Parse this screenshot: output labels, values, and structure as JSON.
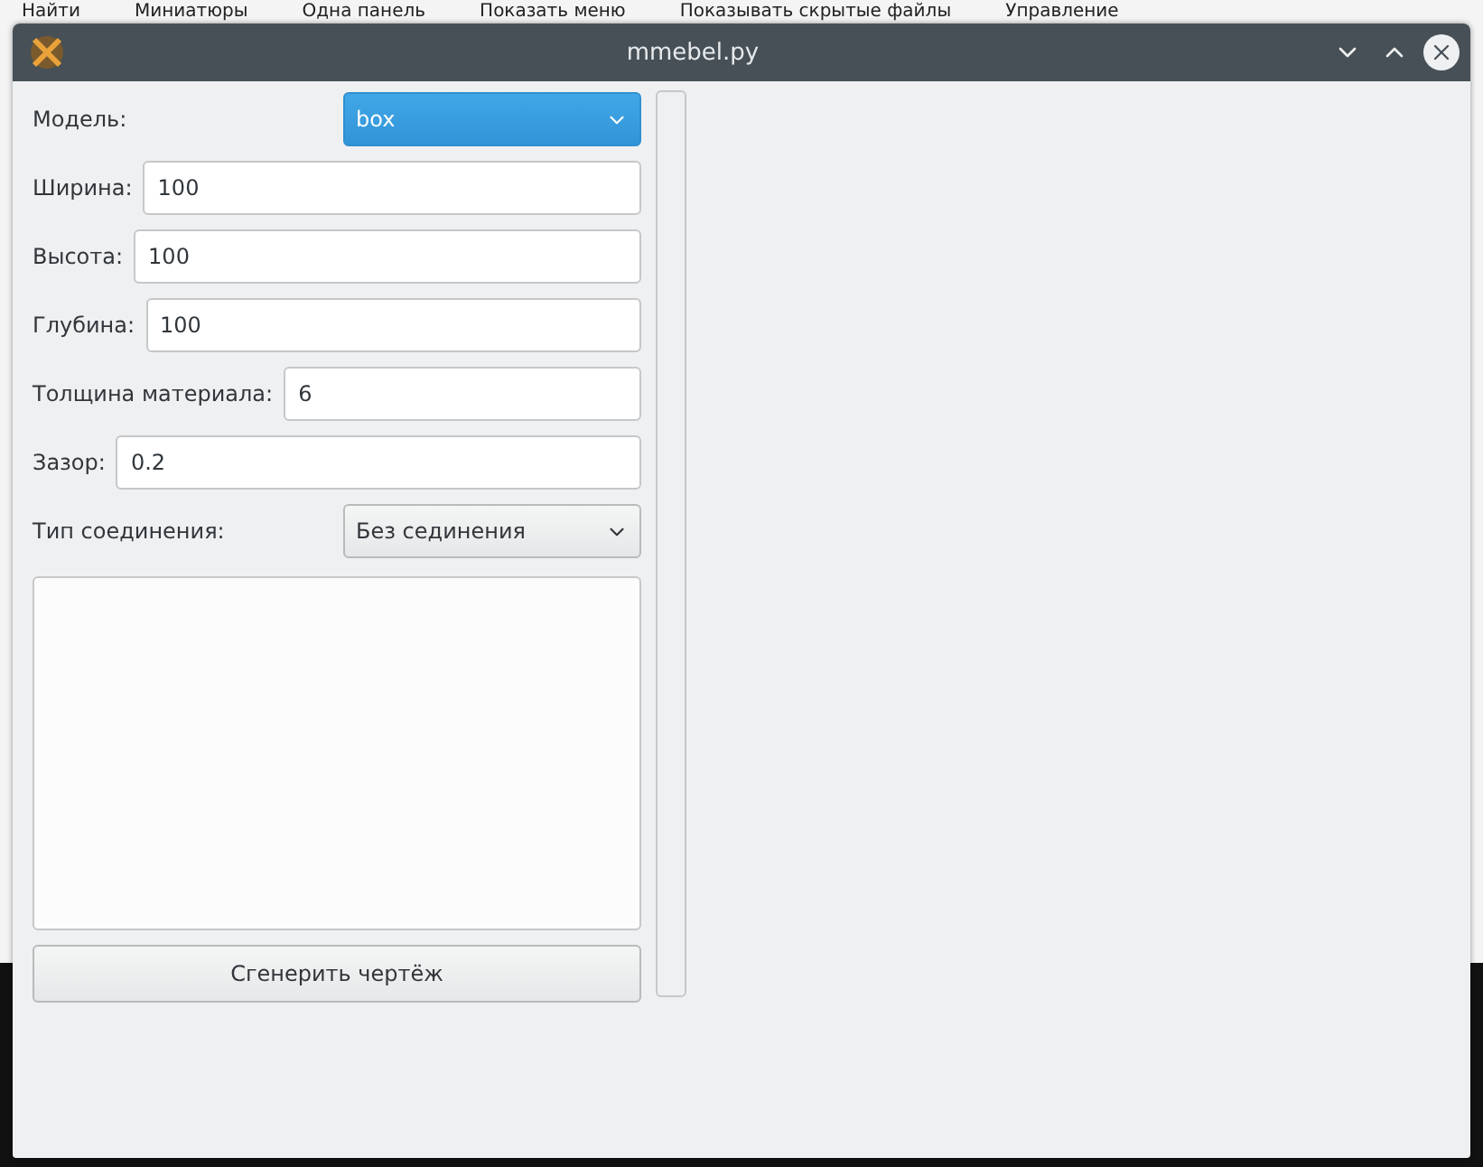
{
  "desktop_toolbar": [
    "Найти",
    "Миниатюры",
    "Одна панель",
    "Показать меню",
    "Показывать скрытые файлы",
    "Управление"
  ],
  "window": {
    "title": "mmebel.py"
  },
  "form": {
    "model": {
      "label": "Модель:",
      "value": "box",
      "focused": true
    },
    "fields": [
      {
        "label": "Ширина:",
        "value": "100"
      },
      {
        "label": "Высота:",
        "value": "100"
      },
      {
        "label": "Глубина:",
        "value": "100"
      },
      {
        "label": "Толщина материала:",
        "value": "6"
      },
      {
        "label": "Зазор:",
        "value": "0.2"
      }
    ],
    "joint": {
      "label": "Тип соединения:",
      "value": "Без сединения",
      "focused": false
    },
    "generate_button": "Сгенерить чертёж"
  }
}
